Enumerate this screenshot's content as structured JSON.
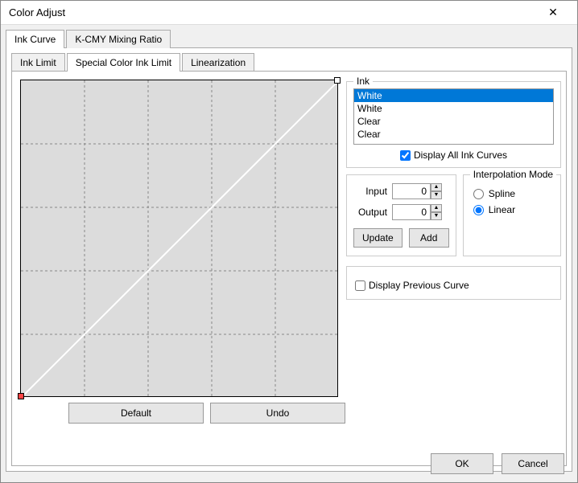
{
  "window": {
    "title": "Color Adjust"
  },
  "outerTabs": {
    "t0": "Ink Curve",
    "t1": "K-CMY Mixing Ratio"
  },
  "innerTabs": {
    "t0": "Ink Limit",
    "t1": "Special Color Ink Limit",
    "t2": "Linearization"
  },
  "inkGroup": {
    "title": "Ink",
    "items": {
      "i0": "White",
      "i1": "White",
      "i2": "Clear",
      "i3": "Clear"
    },
    "displayAll": "Display All Ink Curves"
  },
  "io": {
    "inputLabel": "Input",
    "outputLabel": "Output",
    "inputValue": "0",
    "outputValue": "0",
    "update": "Update",
    "add": "Add"
  },
  "interp": {
    "title": "Interpolation Mode",
    "spline": "Spline",
    "linear": "Linear"
  },
  "displayPrev": "Display Previous Curve",
  "bottom": {
    "default": "Default",
    "undo": "Undo"
  },
  "dialog": {
    "ok": "OK",
    "cancel": "Cancel"
  },
  "chart_data": {
    "type": "line",
    "title": "Ink Curve",
    "xlabel": "Input",
    "ylabel": "Output",
    "xlim": [
      0,
      100
    ],
    "ylim": [
      0,
      100
    ],
    "grid": true,
    "series": [
      {
        "name": "White",
        "x": [
          0,
          100
        ],
        "y": [
          0,
          100
        ]
      }
    ],
    "control_points": [
      {
        "x": 0,
        "y": 0
      },
      {
        "x": 100,
        "y": 100
      }
    ]
  }
}
